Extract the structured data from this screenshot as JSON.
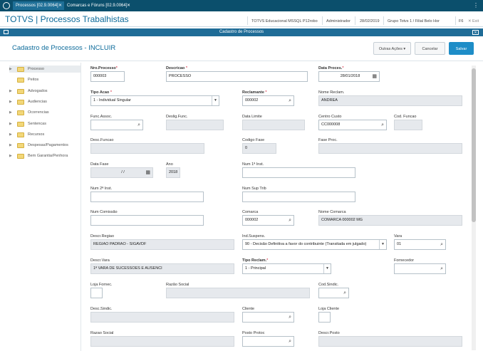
{
  "top_tabs": [
    {
      "label": "Processos [02.9.0064]"
    },
    {
      "label": "Comarcas e Fóruns [02.9.0064]"
    }
  ],
  "header": {
    "brand": "TOTVS | Processos Trabalhistas",
    "items": [
      "TOTVS Educacional MSSQL P12robo",
      "Administrador",
      "28/02/2019",
      "Grupo Totvs 1 / Filial Belo Hor",
      "F6",
      "Exit"
    ]
  },
  "dialog": {
    "title": "Cadastro de Processos"
  },
  "form": {
    "title": "Cadastro de Processos - INCLUIR",
    "outras_acoes": "Outras Ações",
    "cancelar": "Cancelar",
    "salvar": "Salvar"
  },
  "tree": [
    "Processo",
    "Peitos",
    "Advogados",
    "Audiencias",
    "Ocorrencias",
    "Sentencas",
    "Recursos",
    "Despesas/Pagamentos",
    "Bem Garantia/Penhora"
  ],
  "fields": {
    "nro_processo": {
      "label": "Nro.Processo",
      "value": "000003"
    },
    "descricao": {
      "label": "Descricao",
      "value": "PROCESSO"
    },
    "data_proces": {
      "label": "Data Proces.",
      "value": "28/01/2018"
    },
    "tipo_acao": {
      "label": "Tipo Acao",
      "value": "1 - Individual Singular"
    },
    "reclamante": {
      "label": "Reclamante",
      "value": "000002"
    },
    "nome_reclam": {
      "label": "Nome Reclam.",
      "value": "ANDREA"
    },
    "func_assoc": {
      "label": "Func.Assoc.",
      "value": ""
    },
    "deslig_func": {
      "label": "Deslig.Func.",
      "value": ""
    },
    "data_limite": {
      "label": "Data Limite",
      "value": ""
    },
    "centro_custo": {
      "label": "Centro Custo",
      "value": "CC000008"
    },
    "cod_funcao": {
      "label": "Cod. Funcao",
      "value": ""
    },
    "desc_funcao": {
      "label": "Desc.Funcao",
      "value": ""
    },
    "codigo_fase": {
      "label": "Codigo Fase",
      "value": "0"
    },
    "fase_proc": {
      "label": "Fase Proc.",
      "value": ""
    },
    "data_fase": {
      "label": "Data Fase",
      "value": "/ /"
    },
    "ano": {
      "label": "Ano",
      "value": "2018"
    },
    "num_1_inst": {
      "label": "Num 1ª Inst.",
      "value": ""
    },
    "num_2_inst": {
      "label": "Num 2ª Inst.",
      "value": ""
    },
    "num_sup_trib": {
      "label": "Num Sup Trib",
      "value": ""
    },
    "num_comissao": {
      "label": "Num Comissão",
      "value": ""
    },
    "comarca": {
      "label": "Comarca",
      "value": "000002"
    },
    "nome_comarca": {
      "label": "Nome Comarca",
      "value": "COMARCA 000002 MG"
    },
    "descr_regiao": {
      "label": "Descr.Regiao",
      "value": "REGIAO PADRAO - SIGAVDF"
    },
    "ind_suspens": {
      "label": "Ind.Suspens.",
      "value": "90 - Decisão Definitiva a favor do contribuinte (Transitada em julgado)"
    },
    "vara": {
      "label": "Vara",
      "value": "01"
    },
    "descr_vara": {
      "label": "Descr.Vara",
      "value": "1ª VARA DE SUCESSOES E AUSENCI"
    },
    "tipo_reclam": {
      "label": "Tipo Reclam.",
      "value": "1 - Principal"
    },
    "fornecedor": {
      "label": "Fornecedor",
      "value": ""
    },
    "loja_fornec": {
      "label": "Loja Fornec.",
      "value": ""
    },
    "razao_social": {
      "label": "Razão Social",
      "value": ""
    },
    "cod_sindic": {
      "label": "Cod.Sindic.",
      "value": ""
    },
    "desc_sindic": {
      "label": "Desc.Sindic.",
      "value": ""
    },
    "cliente": {
      "label": "Cliente",
      "value": ""
    },
    "loja_cliente": {
      "label": "Loja Cliente",
      "value": ""
    },
    "razao_social2": {
      "label": "Razao Social",
      "value": ""
    },
    "posto_protoc": {
      "label": "Posto Protoc",
      "value": ""
    },
    "descr_posto": {
      "label": "Descr.Posto",
      "value": ""
    }
  },
  "colors": {
    "topbar": "#0b4f6c",
    "brand": "#0b6a9a",
    "dialog_bar": "#1f6c97",
    "save": "#1e8dc7",
    "required": "#d0021b"
  }
}
